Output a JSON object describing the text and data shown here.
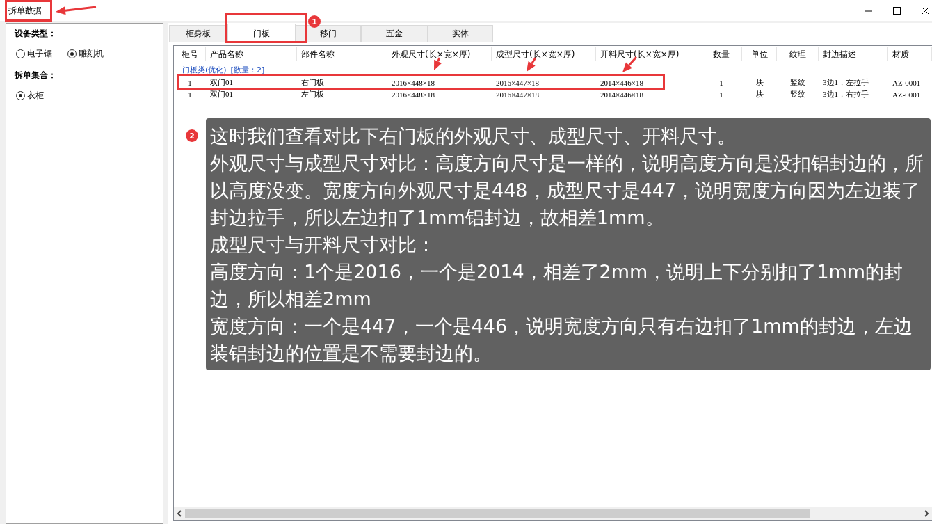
{
  "window": {
    "title": "拆单数据"
  },
  "left_panel": {
    "device_type": {
      "label": "设备类型：",
      "options": [
        {
          "label": "电子锯",
          "selected": false
        },
        {
          "label": "雕刻机",
          "selected": true
        }
      ]
    },
    "split_set": {
      "label": "拆单集合：",
      "options": [
        {
          "label": "衣柜",
          "selected": true
        }
      ]
    }
  },
  "tabs": [
    {
      "label": "柜身板",
      "selected": false
    },
    {
      "label": "门板",
      "selected": true
    },
    {
      "label": "移门",
      "selected": false
    },
    {
      "label": "五金",
      "selected": false
    },
    {
      "label": "实体",
      "selected": false
    }
  ],
  "table": {
    "columns": [
      "柜号",
      "产品名称",
      "部件名称",
      "外观尺寸(长×宽×厚)",
      "成型尺寸(长×宽×厚)",
      "开料尺寸(长×宽×厚)",
      "数量",
      "单位",
      "纹理",
      "封边描述",
      "材质"
    ],
    "group": {
      "name": "门板类(优化)",
      "count": "[数量：2]"
    },
    "rows": [
      [
        "1",
        "双门01",
        "右门板",
        "2016×448×18",
        "2016×447×18",
        "2014×446×18",
        "1",
        "块",
        "竖纹",
        "3边1，左拉手",
        "AZ-0001"
      ],
      [
        "1",
        "双门01",
        "左门板",
        "2016×448×18",
        "2016×447×18",
        "2014×446×18",
        "1",
        "块",
        "竖纹",
        "3边1，右拉手",
        "AZ-0001"
      ]
    ]
  },
  "annotations": {
    "badges": [
      "1",
      "2"
    ],
    "callout": [
      "这时我们查看对比下右门板的外观尺寸、成型尺寸、开料尺寸。",
      "外观尺寸与成型尺寸对比：高度方向尺寸是一样的，说明高度方向是没扣铝封边的，所以高度没变。宽度方向外观尺寸是448，成型尺寸是447，说明宽度方向因为左边装了封边拉手，所以左边扣了1mm铝封边，故相差1mm。",
      "成型尺寸与开料尺寸对比：",
      "高度方向：1个是2016，一个是2014，相差了2mm，说明上下分别扣了1mm的封边，所以相差2mm",
      "宽度方向：一个是447，一个是446，说明宽度方向只有右边扣了1mm的封边，左边装铝封边的位置是不需要封边的。"
    ]
  }
}
